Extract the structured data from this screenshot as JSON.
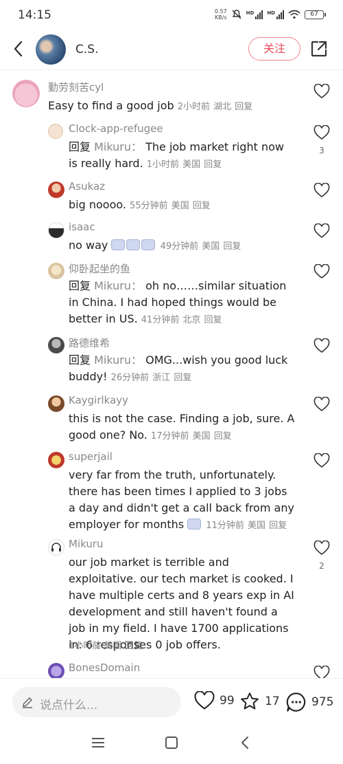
{
  "status_bar": {
    "time": "14:15",
    "net_speed_top": "0.57",
    "net_speed_unit": "KB/s",
    "hd1": "HD",
    "hd2": "HD",
    "battery": "67"
  },
  "header": {
    "username": "C.S.",
    "follow_label": "关注"
  },
  "comments": [
    {
      "author": "勤劳刻苦cyl",
      "text": "Easy to find a good job",
      "time": "2小时前",
      "location": "湖北",
      "reply_label": "回复",
      "likes": ""
    },
    {
      "author": "Clock-app-refugee",
      "reply_prefix": "回复",
      "mention": "Mikuru：",
      "text": "The job market right now is really hard.",
      "time": "1小时前",
      "location": "美国",
      "reply_label": "回复",
      "likes": "3"
    },
    {
      "author": "Asukaz",
      "text": "big noooo.",
      "time": "55分钟前",
      "location": "美国",
      "reply_label": "回复",
      "likes": ""
    },
    {
      "author": "isaac",
      "text": "no way",
      "time": "49分钟前",
      "location": "美国",
      "reply_label": "回复",
      "likes": ""
    },
    {
      "author": "仰卧起坐的鱼",
      "reply_prefix": "回复",
      "mention": "Mikuru：",
      "text": "oh no……similar situation in China. I had hoped things would be better in US.",
      "time": "41分钟前",
      "location": "北京",
      "reply_label": "回复",
      "likes": ""
    },
    {
      "author": "路德维希",
      "reply_prefix": "回复",
      "mention": "Mikuru：",
      "text": "OMG...wish you good luck buddy!",
      "time": "26分钟前",
      "location": "浙江",
      "reply_label": "回复",
      "likes": ""
    },
    {
      "author": "Kaygirlkayy",
      "text": "this is not the case. Finding a job, sure. A good one? No.",
      "time": "17分钟前",
      "location": "美国",
      "reply_label": "回复",
      "likes": ""
    },
    {
      "author": "superjail",
      "text": "very far from the truth, unfortunately. there has been times I applied to 3 jobs a day and didn't get a call back from any employer for months",
      "time": "11分钟前",
      "location": "美国",
      "reply_label": "回复",
      "likes": ""
    },
    {
      "author": "Mikuru",
      "text": "our job market is terrible and exploitative. our tech market is cooked. I have multiple certs and 8 years exp in AI development and still haven't found a job in my field. I have 1700 applications in: 6 responses 0 job offers.",
      "time": "1小时前",
      "location": "美国",
      "reply_label": "回复",
      "likes": "2"
    },
    {
      "author": "BonesDomain",
      "likes": ""
    }
  ],
  "bottom_bar": {
    "input_placeholder": "说点什么...",
    "like_count": "99",
    "star_count": "17",
    "comment_count": "975"
  },
  "colors": {
    "accent": "#e94a5d",
    "meta": "#888888"
  }
}
